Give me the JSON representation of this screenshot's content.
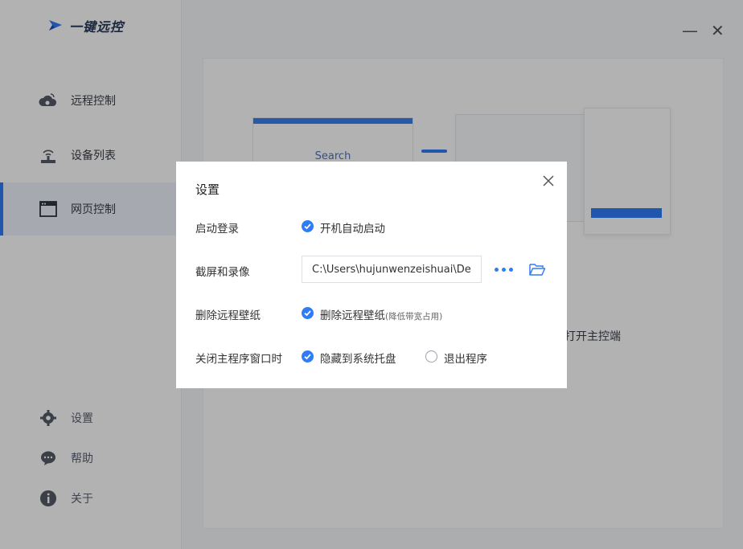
{
  "app": {
    "logo_text": "一键远控",
    "nav": [
      {
        "label": "远程控制",
        "icon": "cloud-remote-icon"
      },
      {
        "label": "设备列表",
        "icon": "device-wifi-icon"
      },
      {
        "label": "网页控制",
        "icon": "browser-window-icon",
        "active": true
      }
    ],
    "bottom": [
      {
        "label": "设置",
        "icon": "gear-icon"
      },
      {
        "label": "帮助",
        "icon": "help-chat-icon"
      },
      {
        "label": "关于",
        "icon": "info-icon"
      }
    ],
    "window_controls": {
      "minimize": "—",
      "close": "✕"
    },
    "background": {
      "illustration_search_text": "Search",
      "partial_text": "打开主控端"
    }
  },
  "dialog": {
    "title": "设置",
    "rows": {
      "startup": {
        "label": "启动登录",
        "option": "开机自动启动",
        "checked": true
      },
      "screenshot": {
        "label": "截屏和录像",
        "path_value": "C:\\Users\\hujunwenzeishuai\\Desktop"
      },
      "wallpaper": {
        "label": "删除远程壁纸",
        "option": "删除远程壁纸",
        "hint": "(降低带宽占用)",
        "checked": true
      },
      "close_main": {
        "label": "关闭主程序窗口时",
        "option_tray": "隐藏到系统托盘",
        "tray_checked": true,
        "option_exit": "退出程序",
        "exit_checked": false
      }
    }
  },
  "colors": {
    "accent": "#2f7cf6",
    "overlay": "rgba(0,0,0,0.30)"
  }
}
